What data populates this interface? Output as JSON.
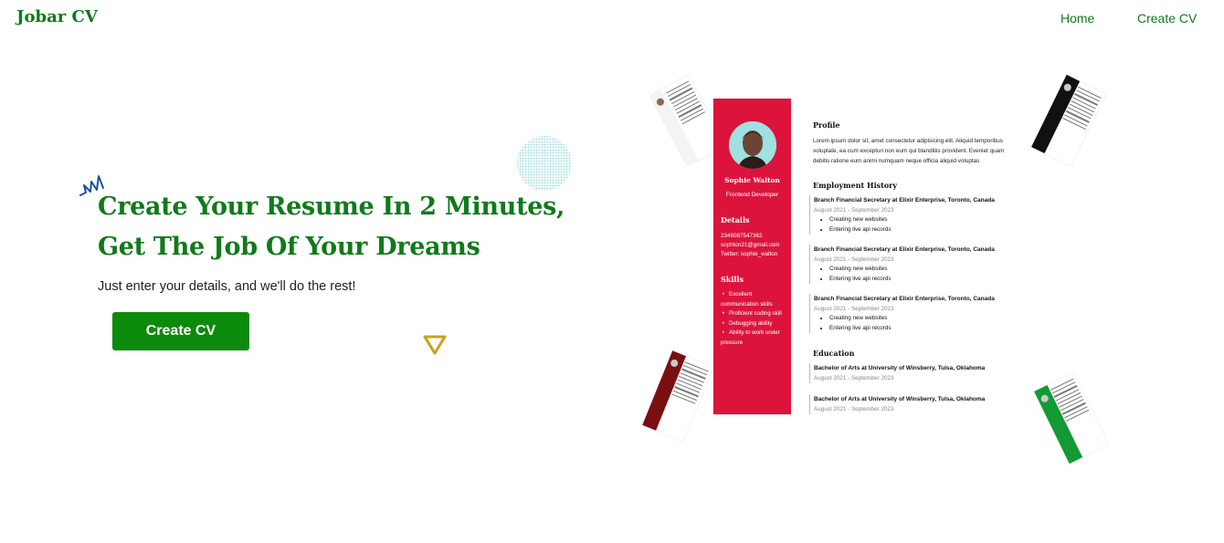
{
  "nav": {
    "logo": "Jobar CV",
    "links": [
      "Home",
      "Create CV"
    ]
  },
  "hero": {
    "title_line1": "Create Your Resume In 2 Minutes,",
    "title_line2": "Get The Job Of Your Dreams",
    "subtitle": "Just enter your details, and we'll do the rest!",
    "cta_label": "Create CV"
  },
  "resume": {
    "name": "Sophie Walton",
    "role": "Frontend Developer",
    "details_heading": "Details",
    "details": [
      "2349087547363",
      "sophton21@gmail.com",
      "Twitter: sophie_walton"
    ],
    "skills_heading": "Skills",
    "skills": [
      "Excellent communication skills",
      "Proficient coding skill",
      "Debugging ability",
      "Ability to work under pressure"
    ],
    "profile_heading": "Profile",
    "profile_text": "Lorem ipsum dolor sit, amet consectetur adipisicing elit. Aliquid temporibus voluptate, ea cum excepturi non eum qui blanditiis provident. Eveniet quam debitis ratione eum animi numquam neque officia aliquid voluptas",
    "employment_heading": "Employment History",
    "jobs": [
      {
        "title": "Branch Financial Secretary at Elixir Enterprise, Toronto, Canada",
        "date": "August 2021 - September 2023",
        "items": [
          "Creating new websites",
          "Entering live api records"
        ]
      },
      {
        "title": "Branch Financial Secretary at Elixir Enterprise, Toronto, Canada",
        "date": "August 2021 - September 2023",
        "items": [
          "Creating new websites",
          "Entering live api records"
        ]
      },
      {
        "title": "Branch Financial Secretary at Elixir Enterprise, Toronto, Canada",
        "date": "August 2021 - September 2023",
        "items": [
          "Creating new websites",
          "Entering live api records"
        ]
      }
    ],
    "education_heading": "Education",
    "education": [
      {
        "title": "Bachelor of Arts at University of Winsberry, Tulsa, Oklahoma",
        "date": "August 2021 - September 2023"
      },
      {
        "title": "Bachelor of Arts at University of Winsberry, Tulsa, Oklahoma",
        "date": "August 2021 - September 2023"
      }
    ]
  },
  "colors": {
    "brand": "#0f7a1a",
    "cta": "#0b8a0b",
    "resume_accent": "#dc143c",
    "triangle": "#c9a21a",
    "scribble": "#1f4fa0"
  }
}
